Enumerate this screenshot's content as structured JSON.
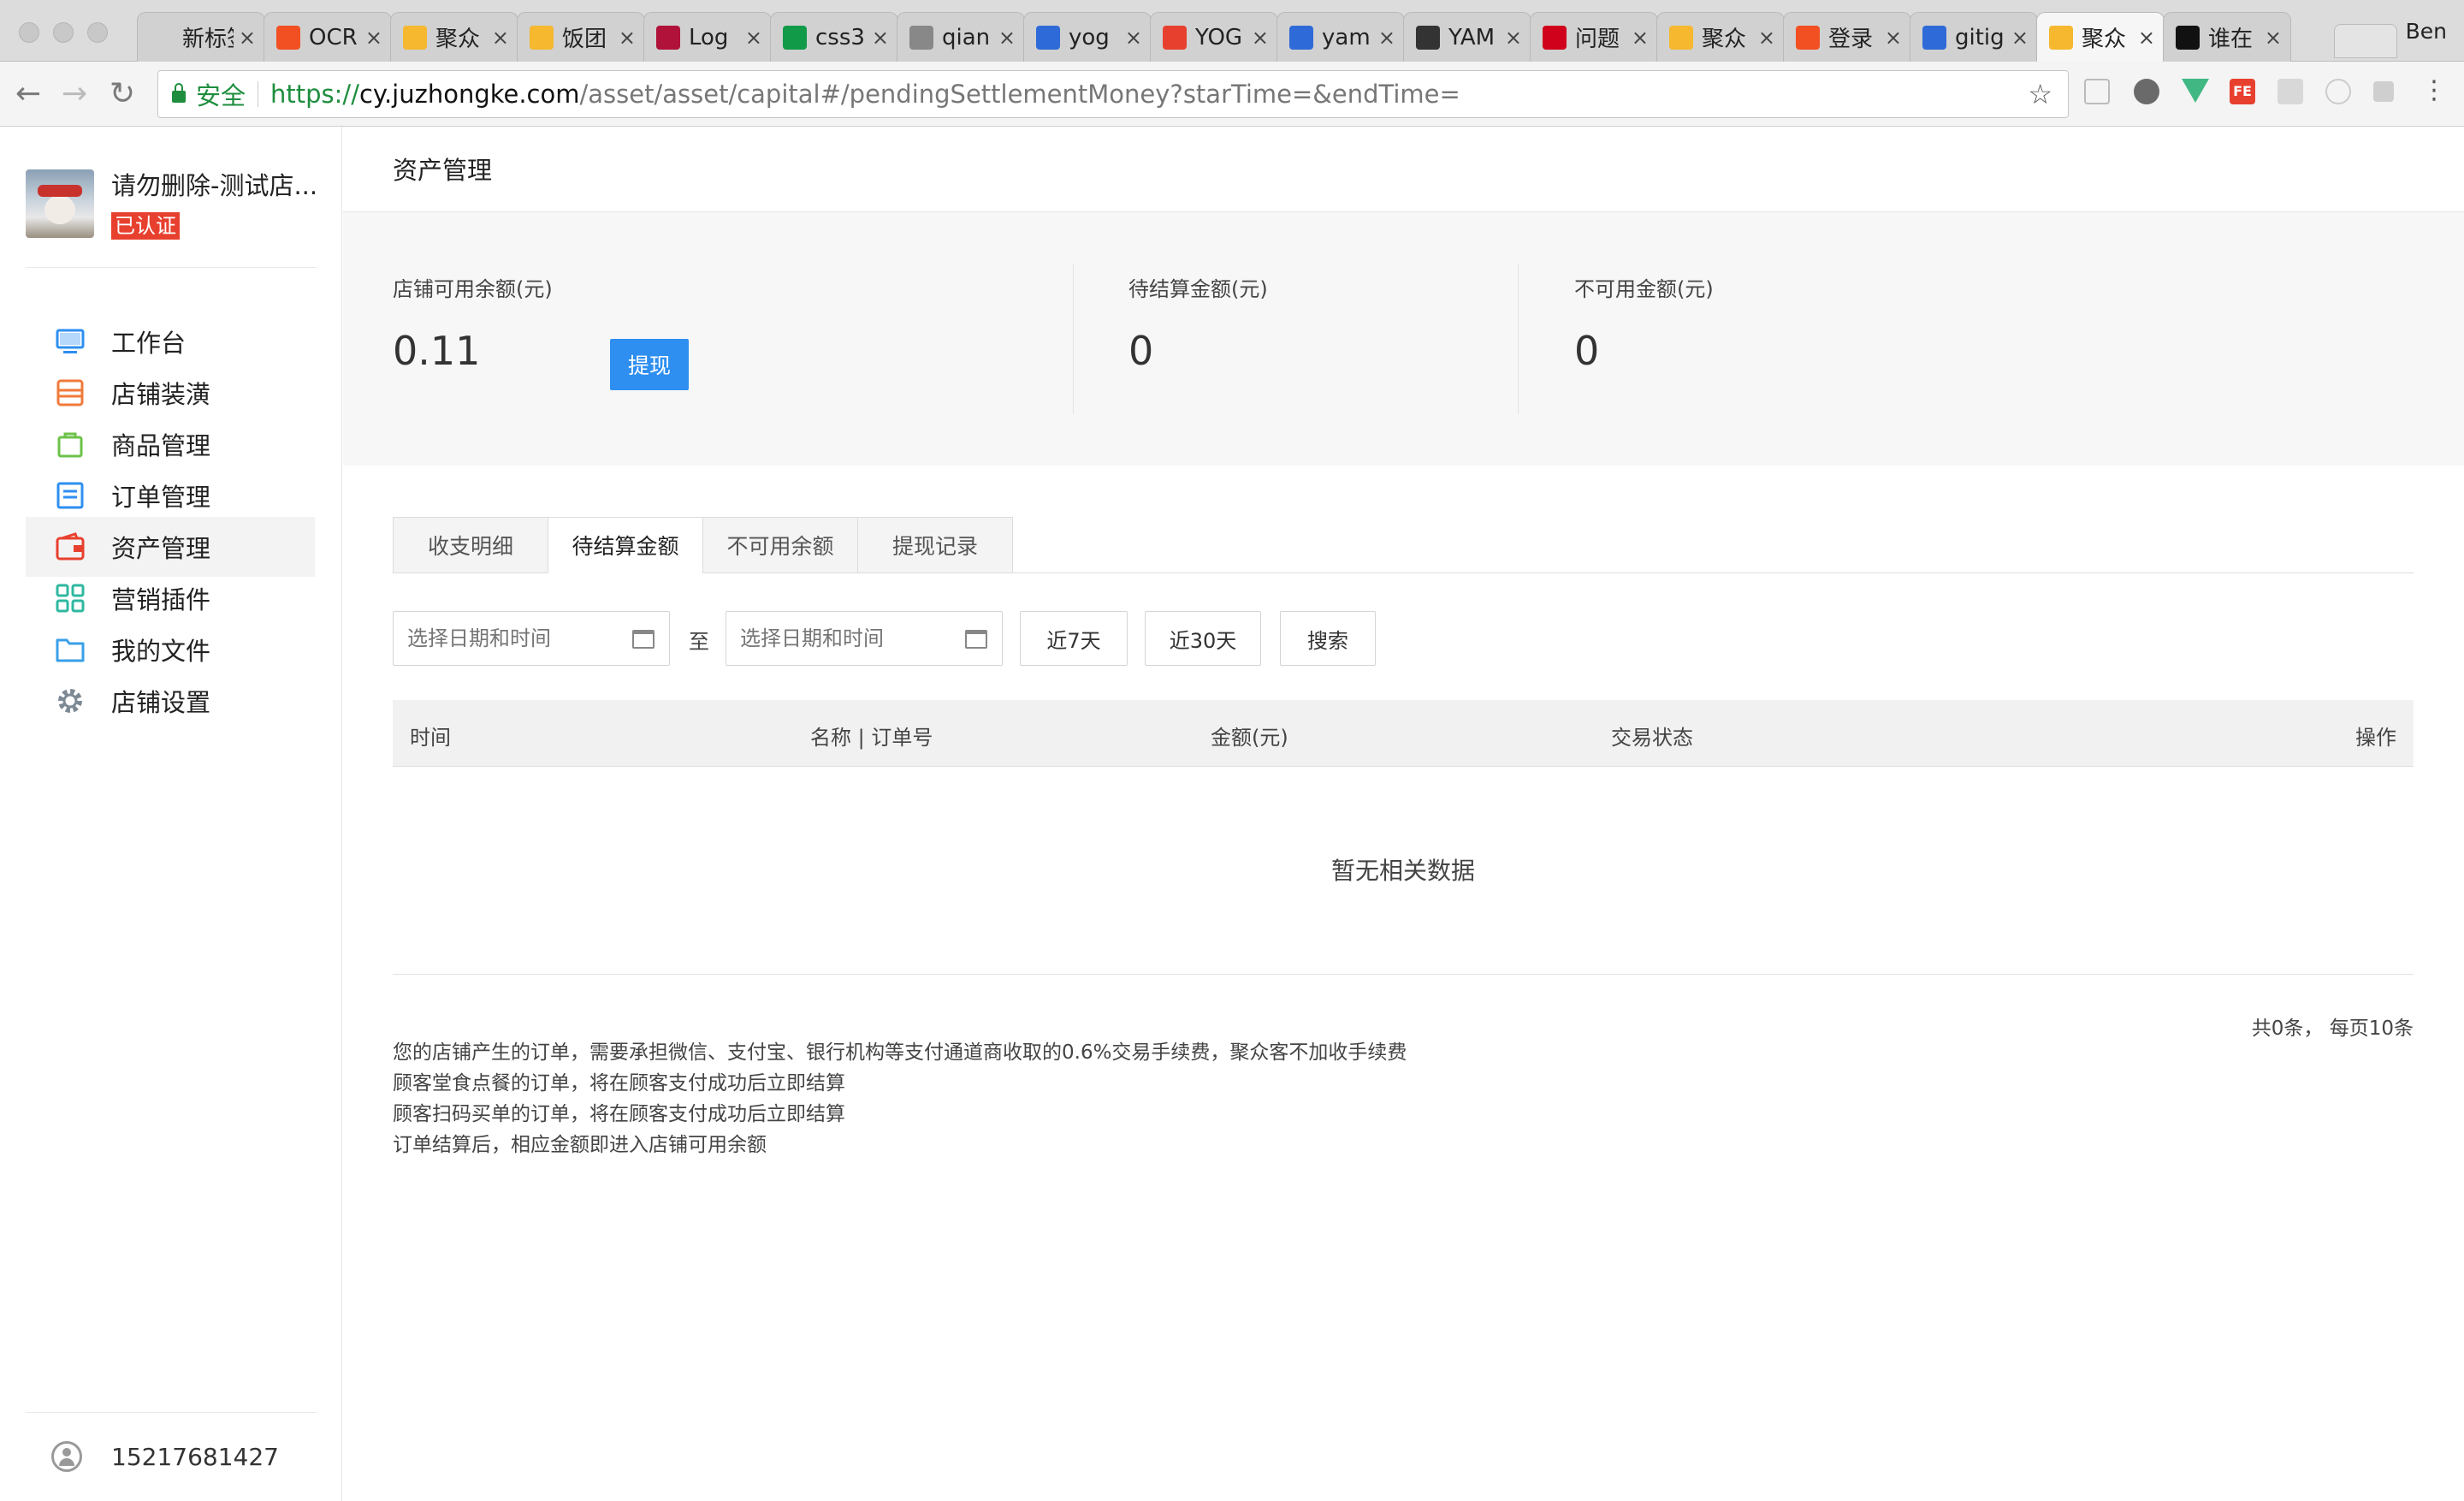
{
  "browser": {
    "tabs": [
      {
        "title": "新标签页",
        "icon": "blank-icon",
        "color": "#d1d1d1"
      },
      {
        "title": "OCR",
        "icon": "microsoft-icon",
        "color": "#f25022"
      },
      {
        "title": "聚众",
        "icon": "jzk-icon",
        "color": "#f5b82e"
      },
      {
        "title": "饭团",
        "icon": "jzk-icon",
        "color": "#f5b82e"
      },
      {
        "title": "Log",
        "icon": "r-icon",
        "color": "#b0123a"
      },
      {
        "title": "css3",
        "icon": "sf-icon",
        "color": "#119a48"
      },
      {
        "title": "qian",
        "icon": "file-icon",
        "color": "#888888"
      },
      {
        "title": "yog",
        "icon": "paw-icon",
        "color": "#2f6bd8"
      },
      {
        "title": "YOG",
        "icon": "fex-icon",
        "color": "#e8402f"
      },
      {
        "title": "yam",
        "icon": "paw-icon",
        "color": "#2f6bd8"
      },
      {
        "title": "YAM",
        "icon": "script-icon",
        "color": "#333333"
      },
      {
        "title": "问题",
        "icon": "gauge-icon",
        "color": "#d0021b"
      },
      {
        "title": "聚众",
        "icon": "jzk-icon",
        "color": "#f5b82e"
      },
      {
        "title": "登录",
        "icon": "microsoft-icon",
        "color": "#f25022"
      },
      {
        "title": "gitig",
        "icon": "paw-icon",
        "color": "#2f6bd8"
      },
      {
        "title": "聚众",
        "icon": "jzk-icon",
        "color": "#f5b82e"
      },
      {
        "title": "谁在",
        "icon": "github-icon",
        "color": "#111111"
      }
    ],
    "profile_name": "Ben",
    "address": {
      "secure_label": "安全",
      "scheme": "https://",
      "host": "cy.juzhongke.com",
      "path": "/asset/asset/capital#/pendingSettlementMoney?starTime=&endTime="
    }
  },
  "sidebar": {
    "shop_name": "请勿删除-测试店...",
    "verified_badge": "已认证",
    "items": [
      {
        "label": "工作台",
        "icon": "monitor-icon",
        "color": "#2e8ff0"
      },
      {
        "label": "店铺装潢",
        "icon": "shop-icon",
        "color": "#f07a3a"
      },
      {
        "label": "商品管理",
        "icon": "bag-icon",
        "color": "#6cc24a"
      },
      {
        "label": "订单管理",
        "icon": "list-icon",
        "color": "#2e8ff0"
      },
      {
        "label": "资产管理",
        "icon": "wallet-icon",
        "color": "#e8402f"
      },
      {
        "label": "营销插件",
        "icon": "grid-icon",
        "color": "#2fb8a0"
      },
      {
        "label": "我的文件",
        "icon": "folder-icon",
        "color": "#3aa0e8"
      },
      {
        "label": "店铺设置",
        "icon": "gear-icon",
        "color": "#7d8a96"
      }
    ],
    "active_index": 4,
    "user_phone": "15217681427"
  },
  "main": {
    "page_title": "资产管理",
    "summary": {
      "available": {
        "label": "店铺可用余额(元)",
        "value": "0.11"
      },
      "withdraw_label": "提现",
      "pending": {
        "label": "待结算金额(元)",
        "value": "0"
      },
      "unavailable": {
        "label": "不可用金额(元)",
        "value": "0"
      }
    },
    "tabs": [
      {
        "label": "收支明细"
      },
      {
        "label": "待结算金额"
      },
      {
        "label": "不可用余额"
      },
      {
        "label": "提现记录"
      }
    ],
    "active_tab": 1,
    "filters": {
      "start_placeholder": "选择日期和时间",
      "end_placeholder": "选择日期和时间",
      "to_label": "至",
      "last7_label": "近7天",
      "last30_label": "近30天",
      "search_label": "搜索"
    },
    "table": {
      "columns": [
        "时间",
        "名称 | 订单号",
        "金额(元)",
        "交易状态",
        "操作"
      ],
      "empty_text": "暂无相关数据"
    },
    "pager": "共0条， 每页10条",
    "notes": [
      "您的店铺产生的订单，需要承担微信、支付宝、银行机构等支付通道商收取的0.6%交易手续费，聚众客不加收手续费",
      "顾客堂食点餐的订单，将在顾客支付成功后立即结算",
      "顾客扫码买单的订单，将在顾客支付成功后立即结算",
      "订单结算后，相应金额即进入店铺可用余额"
    ]
  }
}
